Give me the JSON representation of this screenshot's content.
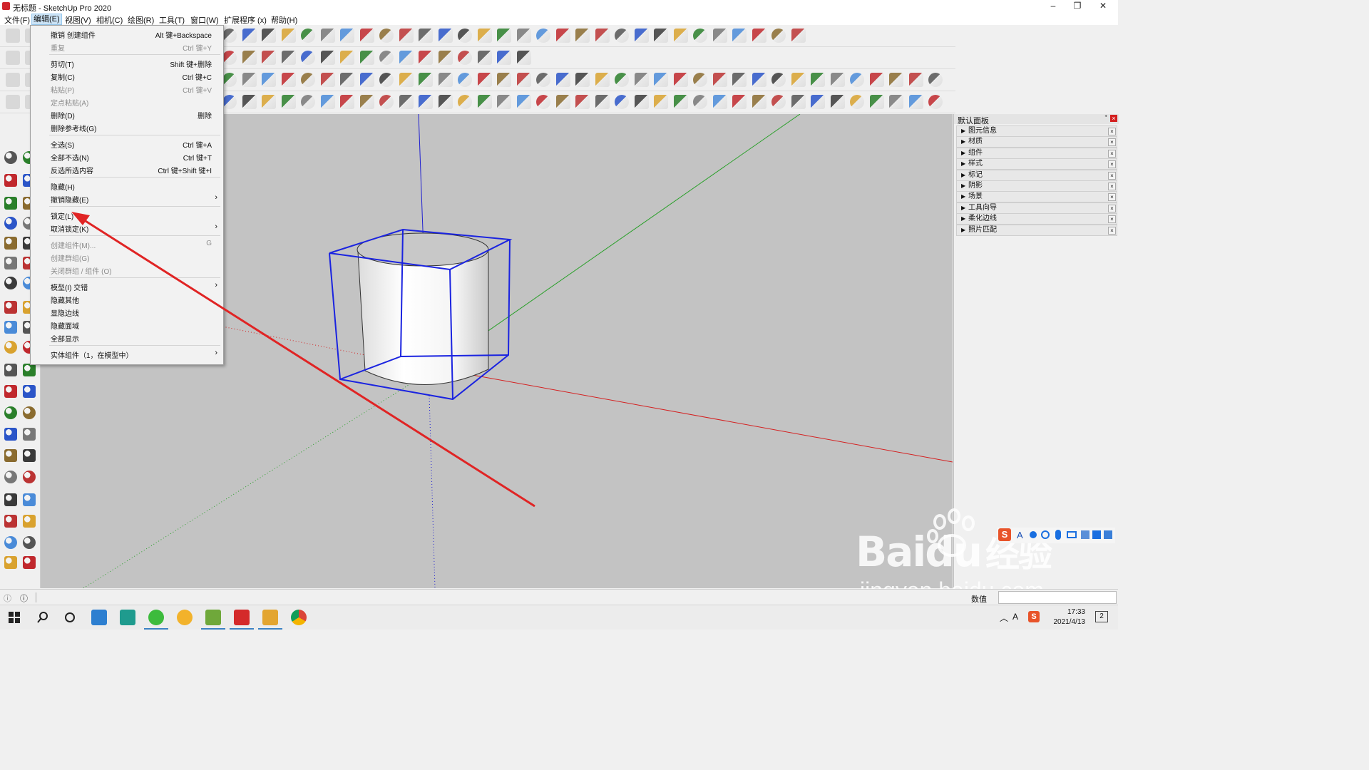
{
  "window": {
    "title": "无标题 - SketchUp Pro 2020",
    "min": "–",
    "max": "❐",
    "close": "✕"
  },
  "menubar": [
    {
      "label": "文件(F)"
    },
    {
      "label": "编辑(E)",
      "active": true
    },
    {
      "label": "视图(V)"
    },
    {
      "label": "相机(C)"
    },
    {
      "label": "绘图(R)"
    },
    {
      "label": "工具(T)"
    },
    {
      "label": "窗口(W)"
    },
    {
      "label": "扩展程序 (x)"
    },
    {
      "label": "帮助(H)"
    }
  ],
  "edit_menu": {
    "items": [
      {
        "label": "撤销 创建组件",
        "shortcut": "Alt 键+Backspace",
        "enabled": true
      },
      {
        "label": "重复",
        "shortcut": "Ctrl 键+Y",
        "enabled": false
      },
      {
        "sep": true
      },
      {
        "label": "剪切(T)",
        "shortcut": "Shift 键+删除",
        "enabled": true
      },
      {
        "label": "复制(C)",
        "shortcut": "Ctrl 键+C",
        "enabled": true
      },
      {
        "label": "粘贴(P)",
        "shortcut": "Ctrl 键+V",
        "enabled": false
      },
      {
        "label": "定点粘贴(A)",
        "shortcut": "",
        "enabled": false
      },
      {
        "label": "删除(D)",
        "shortcut": "删除",
        "enabled": true
      },
      {
        "label": "删除参考线(G)",
        "shortcut": "",
        "enabled": true
      },
      {
        "sep": true
      },
      {
        "label": "全选(S)",
        "shortcut": "Ctrl 键+A",
        "enabled": true
      },
      {
        "label": "全部不选(N)",
        "shortcut": "Ctrl 键+T",
        "enabled": true
      },
      {
        "label": "反选所选内容",
        "shortcut": "Ctrl 键+Shift 键+I",
        "enabled": true
      },
      {
        "sep": true
      },
      {
        "label": "隐藏(H)",
        "shortcut": "",
        "enabled": true
      },
      {
        "label": "撤销隐藏(E)",
        "shortcut": "",
        "enabled": true,
        "submenu": true
      },
      {
        "sep": true
      },
      {
        "label": "锁定(L)",
        "shortcut": "",
        "enabled": true
      },
      {
        "label": "取消锁定(K)",
        "shortcut": "",
        "enabled": true,
        "submenu": true
      },
      {
        "sep": true
      },
      {
        "label": "创建组件(M)...",
        "shortcut": "G",
        "enabled": false
      },
      {
        "label": "创建群组(G)",
        "shortcut": "",
        "enabled": false
      },
      {
        "label": "关闭群组 / 组件 (O)",
        "shortcut": "",
        "enabled": false
      },
      {
        "sep": true
      },
      {
        "label": "模型(I) 交错",
        "shortcut": "",
        "enabled": true,
        "submenu": true
      },
      {
        "label": "隐藏其他",
        "shortcut": "",
        "enabled": true
      },
      {
        "label": "显隐边线",
        "shortcut": "",
        "enabled": true
      },
      {
        "label": "隐藏面域",
        "shortcut": "",
        "enabled": true
      },
      {
        "label": "全部显示",
        "shortcut": "",
        "enabled": true
      },
      {
        "sep": true
      },
      {
        "label": "实体组件（1，在模型中）",
        "shortcut": "",
        "enabled": true,
        "submenu": true
      }
    ]
  },
  "panel": {
    "title": "默认面板",
    "close": "×",
    "pin": "ᐩ",
    "items": [
      "图元信息",
      "材质",
      "组件",
      "样式",
      "标记",
      "阴影",
      "场景",
      "工具向导",
      "柔化边线",
      "照片匹配"
    ]
  },
  "statusbar": {
    "info1": "ⓘ",
    "info2": "ⓘ",
    "measure_label": "数值"
  },
  "taskbar": {
    "time": "17:33",
    "date": "2021/4/13",
    "notification_count": "2",
    "ime": "A"
  },
  "watermark": {
    "brand": "Bai",
    "brand2": "du",
    "cn": "经验",
    "url": "jingyan.baidu.com"
  },
  "colors": {
    "selection": "#1a23e0",
    "red_axis": "#d42020",
    "green_axis": "#2aa02a",
    "blue_axis": "#2020d0",
    "annotation_arrow": "#e02424",
    "viewport_bg": "#c3c3c3"
  }
}
